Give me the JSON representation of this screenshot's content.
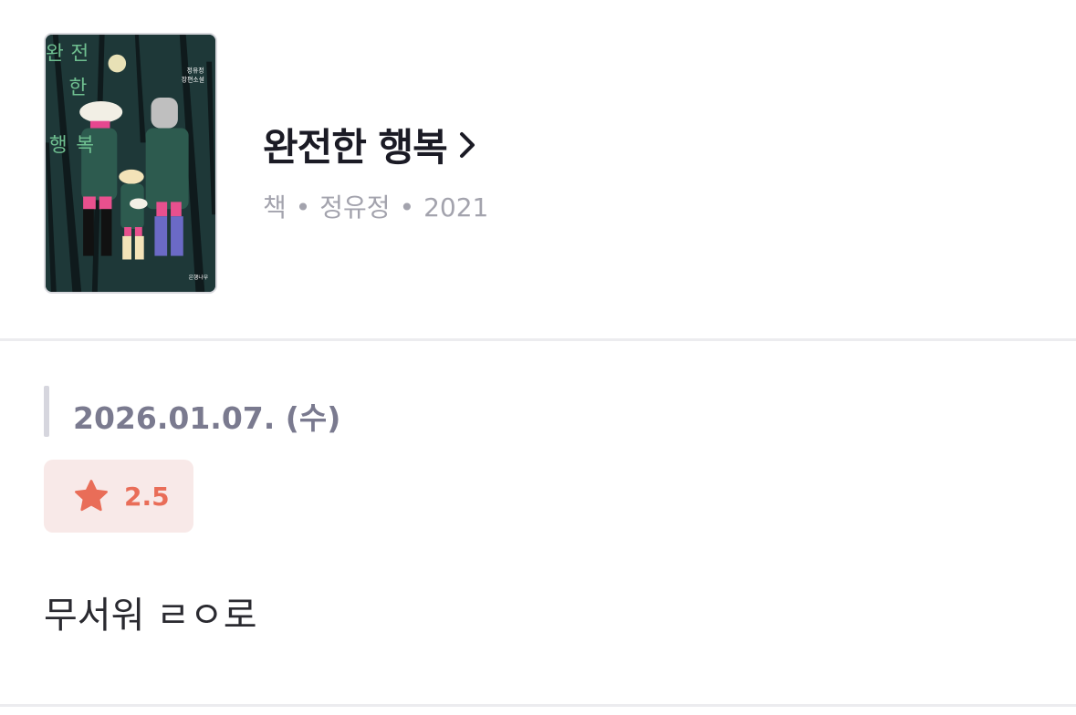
{
  "book": {
    "title": "완전한 행복",
    "type": "책",
    "author": "정유정",
    "year": "2021",
    "separator": "•",
    "cover_title_chars": [
      "완",
      "전",
      "한",
      "행",
      "복"
    ],
    "cover_author_line1": "정유정",
    "cover_author_line2": "장편소설",
    "cover_publisher": "은행나무",
    "icons": {
      "chevron": "chevron-right-icon"
    }
  },
  "entry": {
    "date": "2026.01.07. (수)",
    "rating": "2.5",
    "rating_icon": "star-icon",
    "comment": "무서워 ㄹㅇ로"
  },
  "colors": {
    "accent": "#e96d58",
    "rating_bg": "#f8e9e8",
    "date_text": "#7a7a8f",
    "meta_text": "#a3a3ad"
  }
}
